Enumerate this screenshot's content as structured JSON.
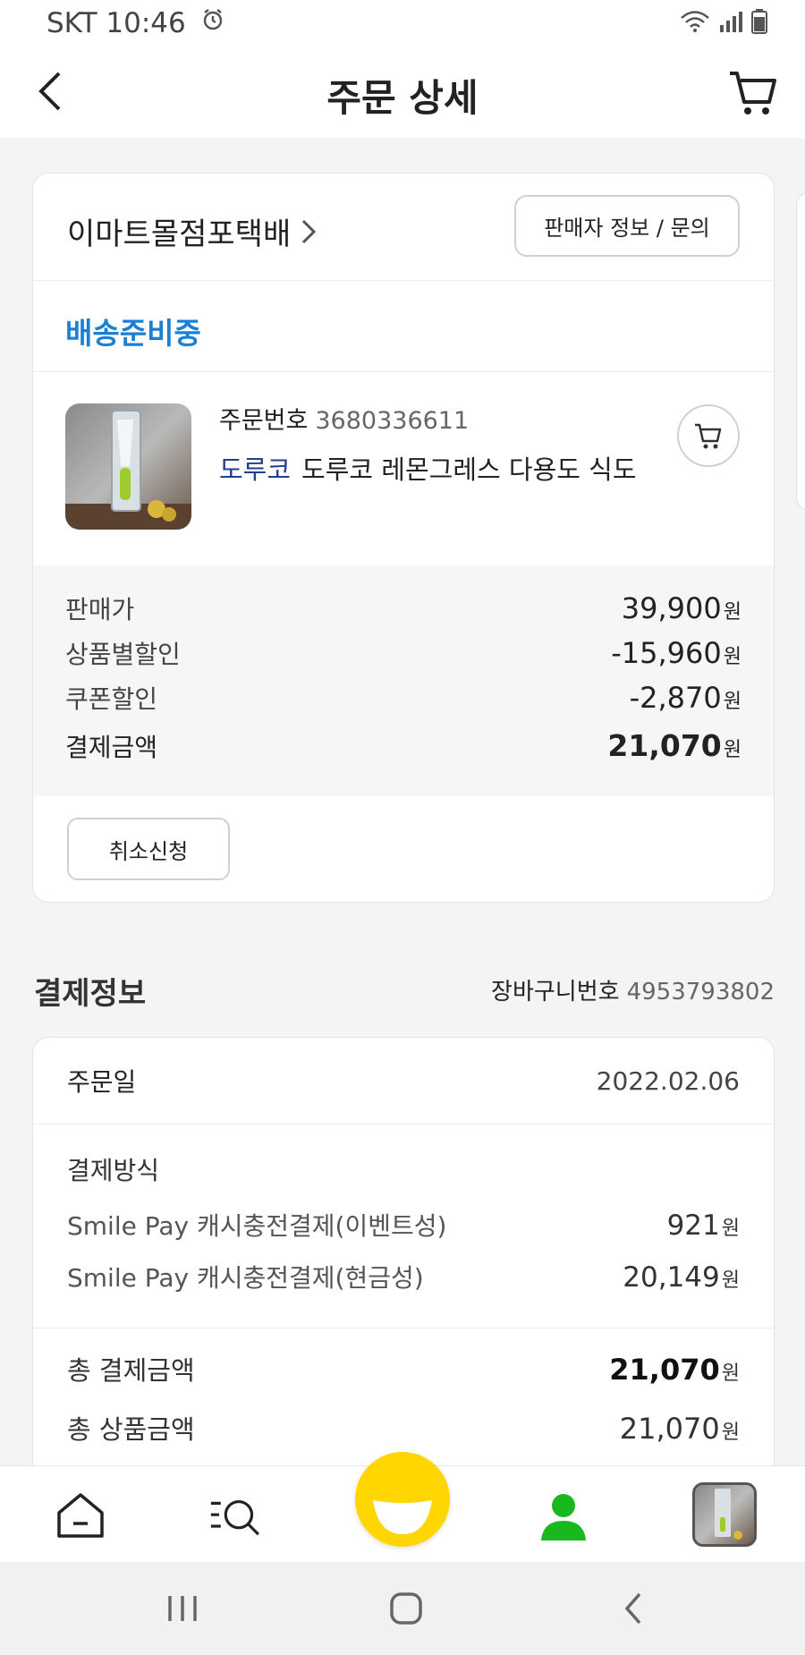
{
  "status_bar": {
    "carrier_time": "SKT 10:46"
  },
  "header": {
    "title": "주문 상세"
  },
  "order": {
    "seller_name": "이마트몰점포택배",
    "seller_info_button": "판매자 정보 / 문의",
    "delivery_status": "배송준비중",
    "order_no_label": "주문번호",
    "order_no": "3680336611",
    "brand": "도루코",
    "product_name": "도루코 레몬그레스 다용도 식도",
    "prices": [
      {
        "label": "판매가",
        "value": "39,900",
        "unit": "원"
      },
      {
        "label": "상품별할인",
        "value": "-15,960",
        "unit": "원"
      },
      {
        "label": "쿠폰할인",
        "value": "-2,870",
        "unit": "원"
      }
    ],
    "total_label": "결제금액",
    "total_value": "21,070",
    "total_unit": "원",
    "cancel_button": "취소신청"
  },
  "payment": {
    "title": "결제정보",
    "cart_no_label": "장바구니번호",
    "cart_no": "4953793802",
    "order_date_label": "주문일",
    "order_date": "2022.02.06",
    "method_title": "결제방식",
    "methods": [
      {
        "label": "Smile Pay 캐시충전결제(이벤트성)",
        "value": "921",
        "unit": "원"
      },
      {
        "label": "Smile Pay 캐시충전결제(현금성)",
        "value": "20,149",
        "unit": "원"
      }
    ],
    "total_pay_label": "총 결제금액",
    "total_pay_value": "21,070",
    "total_product_label": "총 상품금액",
    "total_product_value": "21,070",
    "unit": "원"
  },
  "colors": {
    "accent_blue": "#1b7fd6",
    "brand_navy": "#1f3f8f",
    "nav_yellow": "#ffd600",
    "nav_green": "#19b81e"
  },
  "icons": [
    "back-icon",
    "cart-icon",
    "home-icon",
    "category-search-icon",
    "smile-icon",
    "my-page-icon",
    "recent-item-icon"
  ]
}
